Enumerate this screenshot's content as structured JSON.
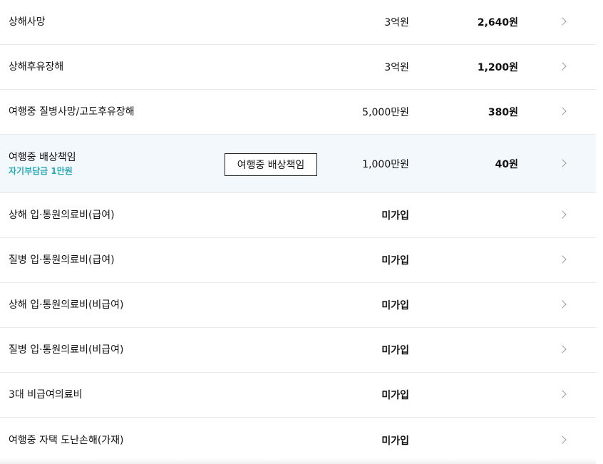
{
  "rows": [
    {
      "name": "상해사망",
      "coverage": "3억원",
      "premium": "2,640원"
    },
    {
      "name": "상해후유장해",
      "coverage": "3억원",
      "premium": "1,200원"
    },
    {
      "name": "여행중 질병사망/고도후유장해",
      "coverage": "5,000만원",
      "premium": "380원"
    },
    {
      "name": "여행중 배상책임",
      "sub": "자기부담금 1만원",
      "coverage": "1,000만원",
      "premium": "40원",
      "tooltip": "여행중 배상책임"
    },
    {
      "name": "상해 입·통원의료비(급여)",
      "coverage": "미가입",
      "premium": ""
    },
    {
      "name": "질병 입·통원의료비(급여)",
      "coverage": "미가입",
      "premium": ""
    },
    {
      "name": "상해 입·통원의료비(비급여)",
      "coverage": "미가입",
      "premium": ""
    },
    {
      "name": "질병 입·통원의료비(비급여)",
      "coverage": "미가입",
      "premium": ""
    },
    {
      "name": "3대 비급여의료비",
      "coverage": "미가입",
      "premium": ""
    },
    {
      "name": "여행중 자택 도난손해(가재)",
      "coverage": "미가입",
      "premium": ""
    }
  ],
  "colors": {
    "highlight_row_bg": "#f3f8fd",
    "sub_text": "#2aa8b4",
    "divider": "#e9e9ee",
    "chevron": "#9a9a9a"
  },
  "icons": {
    "row_chevron": "chevron-right-icon"
  }
}
